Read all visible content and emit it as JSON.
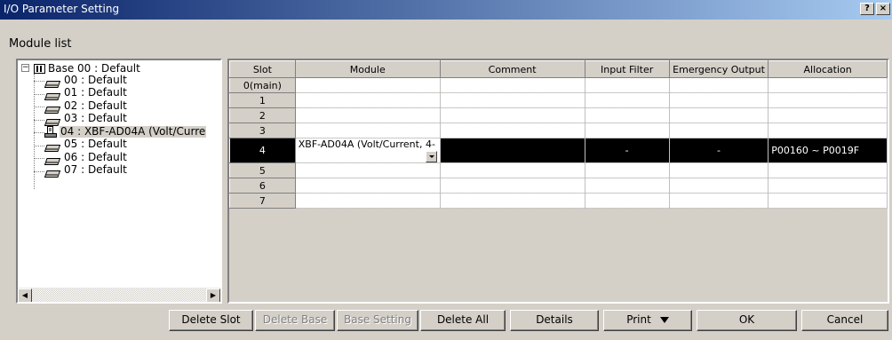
{
  "window": {
    "title": "I/O Parameter Setting",
    "help_btn": "?",
    "close_btn": "×"
  },
  "module_list_label": "Module list",
  "tree": {
    "root": "Base 00 : Default",
    "items": [
      {
        "label": "00 : Default",
        "icon": "slot-empty-icon"
      },
      {
        "label": "01 : Default",
        "icon": "slot-empty-icon"
      },
      {
        "label": "02 : Default",
        "icon": "slot-empty-icon"
      },
      {
        "label": "03 : Default",
        "icon": "slot-empty-icon"
      },
      {
        "label": "04 :  XBF-AD04A (Volt/Curre",
        "icon": "module-icon",
        "selected": true
      },
      {
        "label": "05 : Default",
        "icon": "slot-empty-icon"
      },
      {
        "label": "06 : Default",
        "icon": "slot-empty-icon"
      },
      {
        "label": "07 : Default",
        "icon": "slot-empty-icon"
      }
    ]
  },
  "grid": {
    "columns": [
      "Slot",
      "Module",
      "Comment",
      "Input Filter",
      "Emergency Output",
      "Allocation"
    ],
    "rows": [
      {
        "slot": "0(main)",
        "module": "",
        "comment": "",
        "filter": "",
        "emergency": "",
        "allocation": ""
      },
      {
        "slot": "1",
        "module": "",
        "comment": "",
        "filter": "",
        "emergency": "",
        "allocation": ""
      },
      {
        "slot": "2",
        "module": "",
        "comment": "",
        "filter": "",
        "emergency": "",
        "allocation": ""
      },
      {
        "slot": "3",
        "module": "",
        "comment": "",
        "filter": "",
        "emergency": "",
        "allocation": ""
      },
      {
        "slot": "4",
        "module": "XBF-AD04A (Volt/Current, 4-",
        "comment": "",
        "filter": "-",
        "emergency": "-",
        "allocation": "P00160 ~ P0019F",
        "selected": true
      },
      {
        "slot": "5",
        "module": "",
        "comment": "",
        "filter": "",
        "emergency": "",
        "allocation": ""
      },
      {
        "slot": "6",
        "module": "",
        "comment": "",
        "filter": "",
        "emergency": "",
        "allocation": ""
      },
      {
        "slot": "7",
        "module": "",
        "comment": "",
        "filter": "",
        "emergency": "",
        "allocation": ""
      }
    ]
  },
  "buttons": {
    "delete_slot": "Delete Slot",
    "delete_base": "Delete Base",
    "base_setting": "Base Setting",
    "delete_all": "Delete All",
    "details": "Details",
    "print": "Print",
    "ok": "OK",
    "cancel": "Cancel"
  }
}
